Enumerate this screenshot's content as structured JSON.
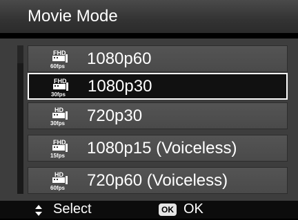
{
  "header": {
    "title": "Movie Mode"
  },
  "items": [
    {
      "label": "1080p60",
      "badge_top": "FHD",
      "badge_bottom": "60fps",
      "selected": false
    },
    {
      "label": "1080p30",
      "badge_top": "FHD",
      "badge_bottom": "30fps",
      "selected": true
    },
    {
      "label": "720p30",
      "badge_top": "HD",
      "badge_bottom": "30fps",
      "selected": false
    },
    {
      "label": "1080p15 (Voiceless)",
      "badge_top": "FHD",
      "badge_bottom": "15fps",
      "selected": false
    },
    {
      "label": "720p60 (Voiceless)",
      "badge_top": "HD",
      "badge_bottom": "60fps",
      "selected": false
    }
  ],
  "footer": {
    "select_label": "Select",
    "ok_icon_text": "OK",
    "ok_label": "OK"
  },
  "icons": {
    "updown": "up-down-arrows-icon",
    "ok_button": "ok-button-icon"
  },
  "colors": {
    "header_bg": "#333333",
    "panel_bg": "#3d3d3d",
    "item_bg": "#4f4f4f",
    "selected_bg": "#111111",
    "selected_border": "#ffffff"
  }
}
